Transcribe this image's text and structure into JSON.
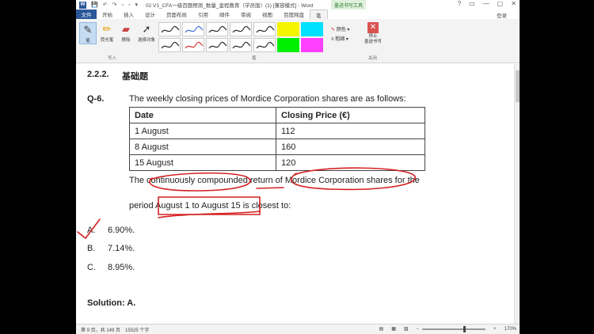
{
  "window": {
    "title": "02 V1_CFA一级百题预测_数量_金程教育（学员版）(1) [兼容模式] - Word",
    "context_tab": "墨迹书写工具",
    "controls": [
      "?",
      "▭",
      "—",
      "▢",
      "✕"
    ],
    "login": "登录"
  },
  "menu": {
    "file": "文件",
    "items": [
      "开始",
      "插入",
      "设计",
      "页面布局",
      "引用",
      "邮件",
      "审阅",
      "视图",
      "百度网盘",
      "笔"
    ],
    "active_index": 9
  },
  "ribbon": {
    "tools": [
      {
        "label": "笔",
        "icon": "pen-icon"
      },
      {
        "label": "荧光笔",
        "icon": "highlighter-icon"
      },
      {
        "label": "擦除",
        "icon": "eraser-icon"
      },
      {
        "label": "选择对象",
        "icon": "select-cursor-icon"
      }
    ],
    "group_write": "写入",
    "group_pens": "笔",
    "options": [
      "颜色 ▾",
      "粗细 ▾"
    ],
    "stop_label": "停止\n墨迹书写",
    "group_close": "关闭",
    "pen_colors": [
      "#2b2b2b",
      "#3a6fd8",
      "#2b2b2b",
      "#2b2b2b",
      "#2b2b2b",
      "#f5f500",
      "#00e0ff",
      "#2b2b2b",
      "#d93030",
      "#2b2b2b",
      "#2b2b2b",
      "#2b2b2b",
      "#00ee00",
      "#ff40ff"
    ]
  },
  "document": {
    "section_number": "2.2.2.",
    "section_title": "基础题",
    "question_id": "Q-6.",
    "question_intro": "The weekly closing prices of Mordice Corporation shares are as follows:",
    "table": {
      "headers": [
        "Date",
        "Closing Price (€)"
      ],
      "rows": [
        [
          "1 August",
          "112"
        ],
        [
          "8 August",
          "160"
        ],
        [
          "15 August",
          "120"
        ]
      ]
    },
    "question_line1": "The continuously compounded return of Mordice Corporation shares for the",
    "question_line2": "period August 1 to August 15 is closest to:",
    "options": [
      {
        "letter": "A.",
        "text": "6.90%."
      },
      {
        "letter": "B.",
        "text": "7.14%."
      },
      {
        "letter": "C.",
        "text": "8.95%."
      }
    ],
    "solution": "Solution: A.",
    "ink_color": "#d42020"
  },
  "status": {
    "page": "第 9 页，共 149 页",
    "words": "15525 个字",
    "zoom": "170%"
  }
}
